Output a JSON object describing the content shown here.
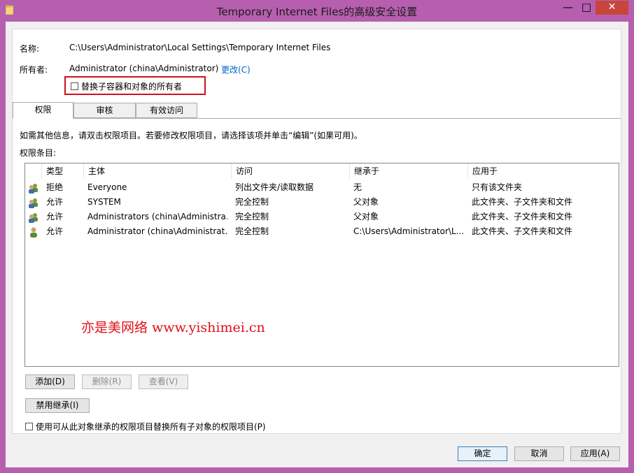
{
  "window": {
    "title": "Temporary Internet Files的高级安全设置",
    "min": "—",
    "max": "□",
    "close": "✕"
  },
  "info": {
    "name_label": "名称:",
    "name_value": "C:\\Users\\Administrator\\Local Settings\\Temporary Internet Files",
    "owner_label": "所有者:",
    "owner_value": "Administrator (china\\Administrator)",
    "change_link": "更改(C)",
    "replace_owner_label": "替换子容器和对象的所有者"
  },
  "tabs": [
    {
      "label": "权限"
    },
    {
      "label": "审核"
    },
    {
      "label": "有效访问"
    }
  ],
  "instructions": "如需其他信息，请双击权限项目。若要修改权限项目，请选择该项并单击“编辑”(如果可用)。",
  "entries_label": "权限条目:",
  "table": {
    "columns": [
      "类型",
      "主体",
      "访问",
      "继承于",
      "应用于"
    ],
    "rows": [
      {
        "type": "拒绝",
        "principal": "Everyone",
        "access": "列出文件夹/读取数据",
        "inherited": "无",
        "applies": "只有该文件夹",
        "icon": "group-icon"
      },
      {
        "type": "允许",
        "principal": "SYSTEM",
        "access": "完全控制",
        "inherited": "父对象",
        "applies": "此文件夹、子文件夹和文件",
        "icon": "group-icon"
      },
      {
        "type": "允许",
        "principal": "Administrators (china\\Administra...",
        "access": "完全控制",
        "inherited": "父对象",
        "applies": "此文件夹、子文件夹和文件",
        "icon": "group-icon"
      },
      {
        "type": "允许",
        "principal": "Administrator (china\\Administrat...",
        "access": "完全控制",
        "inherited": "C:\\Users\\Administrator\\L...",
        "applies": "此文件夹、子文件夹和文件",
        "icon": "user-icon"
      }
    ]
  },
  "watermark": "亦是美网络 www.yishimei.cn",
  "buttons": {
    "add": "添加(D)",
    "remove": "删除(R)",
    "view": "查看(V)",
    "disable_inherit": "禁用继承(I)",
    "replace_children": "使用可从此对象继承的权限项目替换所有子对象的权限项目(P)",
    "ok": "确定",
    "cancel": "取消",
    "apply": "应用(A)"
  }
}
